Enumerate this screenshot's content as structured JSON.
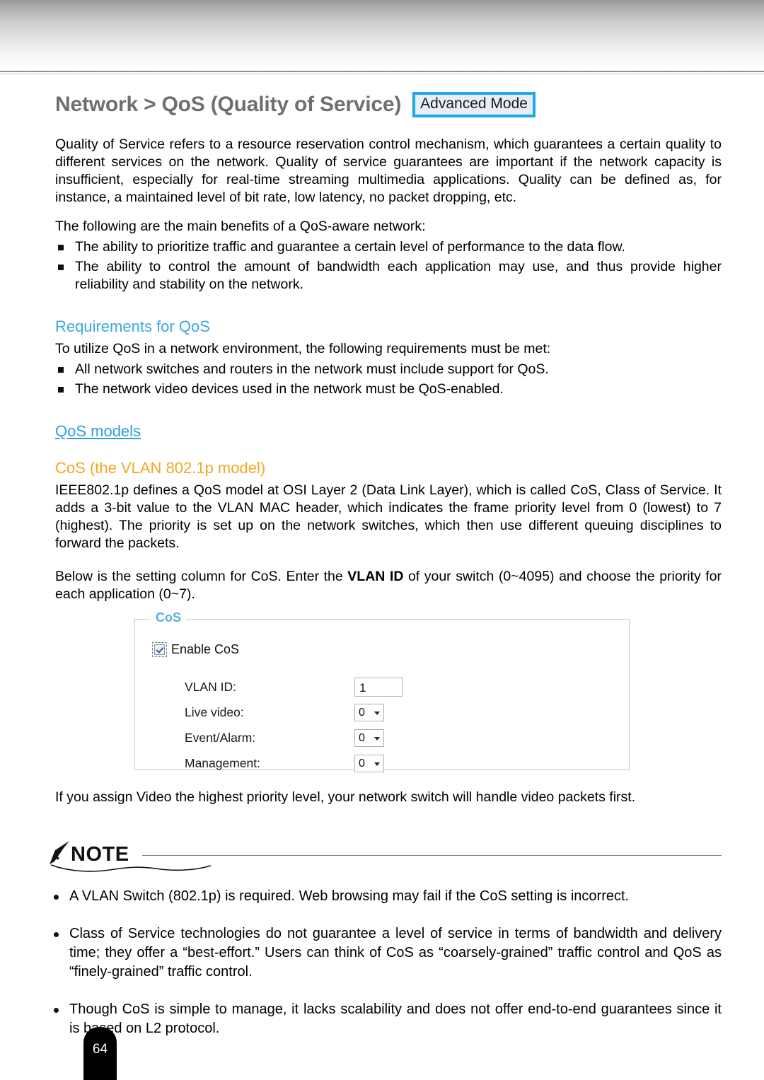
{
  "header": {
    "title": "Network > QoS (Quality of Service)",
    "mode_badge": "Advanced Mode"
  },
  "intro": {
    "paragraph": "Quality of Service refers to a resource reservation control mechanism, which guarantees a certain quality to different services on the network. Quality of service guarantees are important if the network capacity is insufficient, especially for real-time streaming multimedia applications. Quality can be defined as, for instance, a maintained level of bit rate, low latency, no packet dropping, etc.",
    "benefits_lead": "The following are the main benefits of a QoS-aware network:",
    "benefits": [
      "The ability to prioritize traffic and guarantee a certain level of performance to the data flow.",
      "The ability to control the amount of bandwidth each application may use, and thus provide higher reliability and stability on the network."
    ]
  },
  "requirements": {
    "heading": "Requirements for QoS",
    "lead": "To utilize QoS in a network environment, the following requirements must be met:",
    "items": [
      "All network switches and routers in the network must include support for QoS.",
      "The network video devices used in the network must be QoS-enabled."
    ]
  },
  "models": {
    "heading": "QoS models",
    "cos_heading": "CoS (the VLAN 802.1p model)",
    "cos_paragraph": "IEEE802.1p defines a QoS model at OSI Layer 2 (Data Link Layer), which is called CoS, Class of Service. It adds a 3-bit value to the VLAN MAC header, which indicates the frame priority level from 0 (lowest) to 7 (highest). The priority is set up on the network switches, which then use different queuing disciplines to forward the packets.",
    "setting_lead_a": "Below is the setting column for CoS. Enter the ",
    "setting_lead_bold": "VLAN ID",
    "setting_lead_b": " of your switch (0~4095) and choose the priority for each application (0~7).",
    "after_figure": "If you assign Video the highest priority level, your network switch will handle video packets first."
  },
  "cos_form": {
    "legend": "CoS",
    "enable_label": "Enable CoS",
    "enable_checked": true,
    "fields": [
      {
        "label": "VLAN ID:",
        "value": "1",
        "type": "text"
      },
      {
        "label": "Live video:",
        "value": "0",
        "type": "select"
      },
      {
        "label": "Event/Alarm:",
        "value": "0",
        "type": "select"
      },
      {
        "label": "Management:",
        "value": "0",
        "type": "select"
      }
    ]
  },
  "note": {
    "title": "NOTE",
    "items": [
      "A VLAN Switch (802.1p) is required. Web browsing may fail if the CoS setting is incorrect.",
      "Class of Service technologies do not guarantee a level of service in terms of bandwidth and delivery time; they offer a “best-effort.” Users can think of CoS as “coarsely-grained” traffic control and QoS as “finely-grained” traffic control.",
      "Though CoS is simple to manage, it lacks scalability and does not offer end-to-end guarantees since it is based on L2 protocol."
    ]
  },
  "footer": {
    "page_number": "64"
  },
  "colors": {
    "badge_border": "#1fa8e8",
    "badge_fill": "#e8eef6",
    "heading_blue": "#3ba7e0",
    "heading_orange": "#f6a623",
    "legend_blue": "#5aaede",
    "title_gray": "#6f6f6f"
  }
}
